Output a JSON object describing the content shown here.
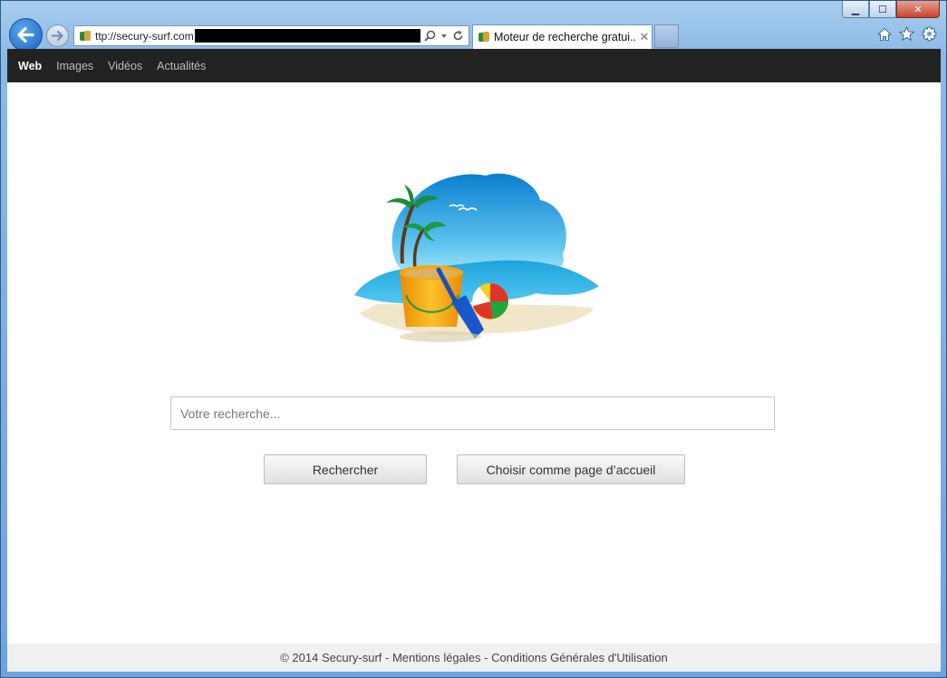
{
  "browser": {
    "address_url": "ttp://secury-surf.com",
    "tab_title": "Moteur de recherche gratui...",
    "tab_close": "✕",
    "caption": {
      "minimize": "▁",
      "maximize": "☐",
      "close": "✕"
    }
  },
  "nav": {
    "items": [
      "Web",
      "Images",
      "Vidéos",
      "Actualités"
    ],
    "active": "Web"
  },
  "search": {
    "placeholder": "Votre recherche..."
  },
  "buttons": {
    "search_label": "Rechercher",
    "homepage_label": "Choisir comme page d’accueil"
  },
  "footer": {
    "text": "© 2014 Secury-surf - Mentions légales - Conditions Générales d'Utilisation"
  },
  "icons": {
    "back": "back-arrow-icon",
    "forward": "forward-arrow-icon",
    "search": "magnifier-icon",
    "refresh": "refresh-icon",
    "home": "home-icon",
    "favorites": "star-icon",
    "tools": "gear-icon"
  },
  "colors": {
    "navbar_bg": "#222222",
    "window_frame": "#8bb9e6",
    "footer_bg": "#f0f0f0"
  }
}
